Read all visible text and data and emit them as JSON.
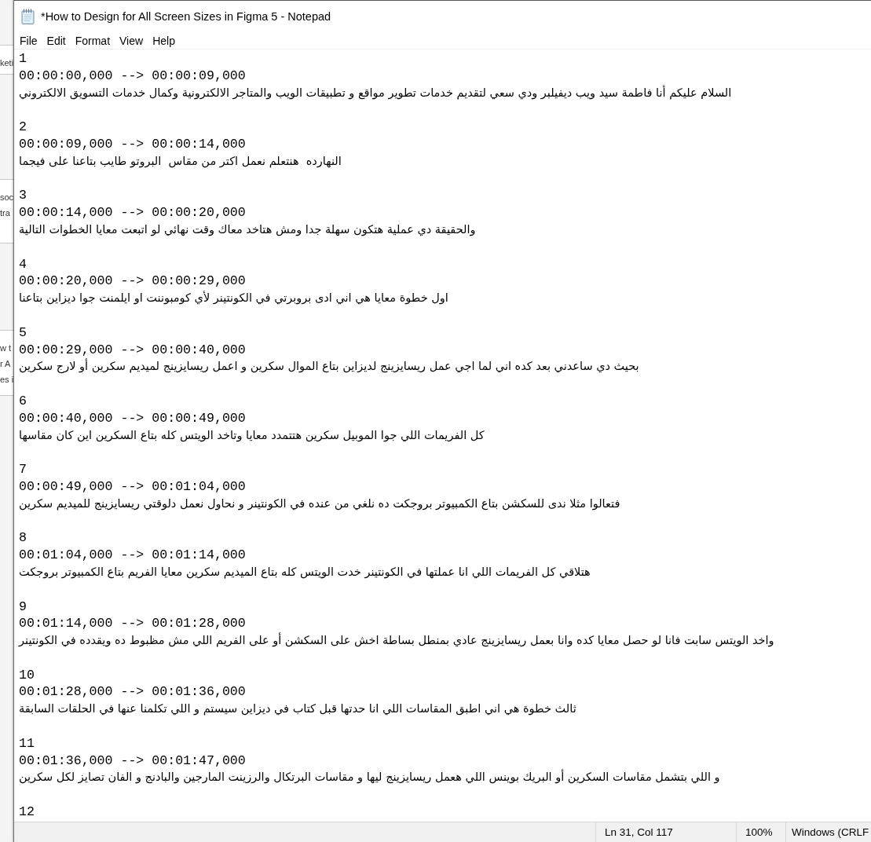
{
  "background_window": {
    "rows": [
      [
        "keti"
      ],
      [
        "soc",
        "tra"
      ],
      [
        "w t",
        "r A",
        "es i"
      ]
    ]
  },
  "window": {
    "title": "*How to Design for All Screen Sizes in Figma 5 - Notepad"
  },
  "menu_bar": {
    "items": [
      "File",
      "Edit",
      "Format",
      "View",
      "Help"
    ]
  },
  "editor": {
    "entries": [
      {
        "index": "1",
        "timing": "00:00:00,000 --> 00:00:09,000",
        "text": "السلام عليكم أنا فاطمة سيد ويب ديفيلبر ودي سعي لتقديم خدمات تطوير مواقع و تطبيقات الويب والمتاجر الالكترونية وكمال خدمات التسويق الالكتروني"
      },
      {
        "index": "2",
        "timing": "00:00:09,000 --> 00:00:14,000",
        "text": "النهارده  هنتعلم نعمل اكتر من مقاس  البروتو طايب بتاعنا على فيجما"
      },
      {
        "index": "3",
        "timing": "00:00:14,000 --> 00:00:20,000",
        "text": "والحقيقة دي عملية هتكون سهلة جدا ومش هتاخد معاك وقت نهائي لو اتبعت معايا الخطوات التالية"
      },
      {
        "index": "4",
        "timing": "00:00:20,000 --> 00:00:29,000",
        "text": "اول خطوة معايا هي اني ادى بروبرتي في الكونتينر لأي كومبوننت او ايلمنت جوا ديزاين بتاعنا"
      },
      {
        "index": "5",
        "timing": "00:00:29,000 --> 00:00:40,000",
        "text": "بحيث دي ساعدني بعد كده اني لما اجي عمل ريسايزينج لديزاين بتاع الموال سكرين و اعمل ريسايزينج لميديم سكرين أو لارج سكرين"
      },
      {
        "index": "6",
        "timing": "00:00:40,000 --> 00:00:49,000",
        "text": "كل الفريمات اللي جوا الموبيل سكرين هتتمدد معايا وتاخد الويتس كله بتاع السكرين اين كان مقاسها"
      },
      {
        "index": "7",
        "timing": "00:00:49,000 --> 00:01:04,000",
        "text": "فتعالوا مثلا ندى للسكشن بتاع الكمبيوتر بروجكت ده نلغي من عنده في الكونتينر و نحاول نعمل دلوقتي ريسايزينج للميديم سكرين"
      },
      {
        "index": "8",
        "timing": "00:01:04,000 --> 00:01:14,000",
        "text": "هتلاقي كل الفريمات اللي انا عملتها في الكونتينر خدت الويتس كله بتاع الميديم سكرين معايا الفريم بتاع الكمبيوتر بروجكت"
      },
      {
        "index": "9",
        "timing": "00:01:14,000 --> 00:01:28,000",
        "text": "واخد الويتس سابت فانا لو حصل معايا كده وانا بعمل ريسايزينج عادي بمنطل بساطة اخش على السكشن أو على الفريم اللي مش مظبوط ده ويقدده في الكونتينر"
      },
      {
        "index": "10",
        "timing": "00:01:28,000 --> 00:01:36,000",
        "text": "ثالث خطوة هي اني اطبق المقاسات اللي انا حدتها قبل كتاب في ديزاين سيستم و اللي تكلمنا عنها في الحلقات السابقة"
      },
      {
        "index": "11",
        "timing": "00:01:36,000 --> 00:01:47,000",
        "text": "و اللي بتشمل مقاسات السكرين أو البريك بوينس اللي هعمل ريسايزينج ليها و مقاسات البرتكال والرزينت المارجين والبادنج و الفان تصايز لكل سكرين"
      },
      {
        "index": "12"
      }
    ]
  },
  "status_bar": {
    "position": "Ln 31, Col 117",
    "zoom": "100%",
    "line_endings": "Windows (CRLF"
  }
}
